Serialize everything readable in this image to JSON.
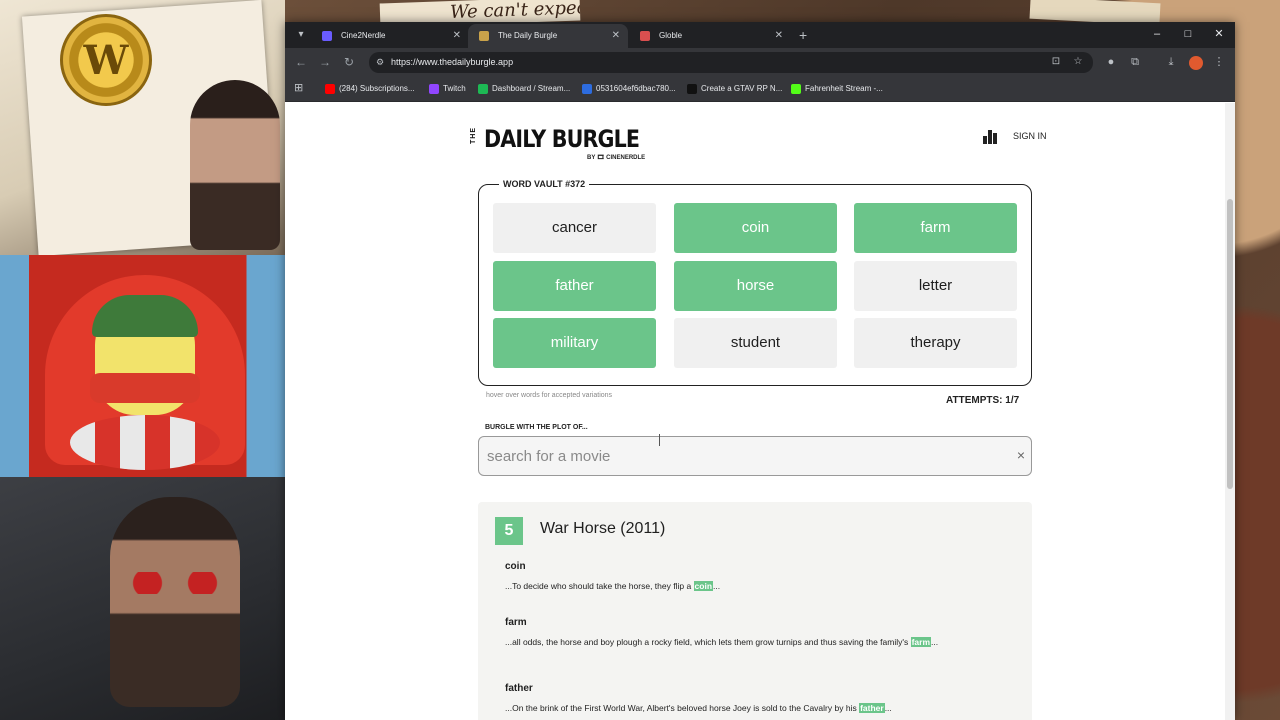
{
  "overlay": {
    "poster_text": "We can't expect",
    "coin_letter": "W"
  },
  "browser": {
    "tabs": [
      {
        "title": "Cine2Nerdle",
        "color": "#6a5cff",
        "active": false
      },
      {
        "title": "The Daily Burgle",
        "color": "#c9a24a",
        "active": true
      },
      {
        "title": "Globle",
        "color": "#d94f4f",
        "active": false
      }
    ],
    "new_tab_icon": "plus-icon",
    "window_controls": [
      "–",
      "□",
      "✕"
    ],
    "url": "https://www.thedailyburgle.app",
    "bookmarks": [
      {
        "label": "(284) Subscriptions...",
        "color": "#ff0000"
      },
      {
        "label": "Twitch",
        "color": "#9146ff"
      },
      {
        "label": "Dashboard / Stream...",
        "color": "#1db954"
      },
      {
        "label": "0531604ef6dbac780...",
        "color": "#2d6cdf"
      },
      {
        "label": "Create a GTAV RP N...",
        "color": "#111111"
      },
      {
        "label": "Fahrenheit Stream -...",
        "color": "#53fc18"
      }
    ]
  },
  "site": {
    "logo_the": "THE",
    "logo_name": "DAILY BURGLE",
    "logo_by": "BY 🎞 CINENERDLE",
    "signin": "SIGN IN",
    "vault_label": "WORD VAULT #372",
    "words": [
      {
        "text": "cancer",
        "found": false
      },
      {
        "text": "coin",
        "found": true
      },
      {
        "text": "farm",
        "found": true
      },
      {
        "text": "father",
        "found": true
      },
      {
        "text": "horse",
        "found": true
      },
      {
        "text": "letter",
        "found": false
      },
      {
        "text": "military",
        "found": true
      },
      {
        "text": "student",
        "found": false
      },
      {
        "text": "therapy",
        "found": false
      }
    ],
    "hover_hint": "hover over words for accepted variations",
    "attempts": "ATTEMPTS: 1/7",
    "search_label": "BURGLE WITH THE PLOT OF...",
    "search_placeholder": "search for a movie",
    "clear": "×"
  },
  "result": {
    "score": "5",
    "title": "War Horse (2011)",
    "matches": [
      {
        "word": "coin",
        "before": "...To decide who should take the horse, they flip a ",
        "hit": "coin",
        "after": "..."
      },
      {
        "word": "farm",
        "before": "...all odds, the horse and boy plough a rocky field, which lets them grow turnips and thus saving the family's ",
        "hit": "farm",
        "after": "..."
      },
      {
        "word": "father",
        "before": "...On the brink of the First World War, Albert's beloved horse Joey is sold to the Cavalry by his ",
        "hit": "father",
        "after": "..."
      }
    ]
  },
  "colors": {
    "found": "#6bc58a",
    "unfound": "#f0f0f0"
  }
}
